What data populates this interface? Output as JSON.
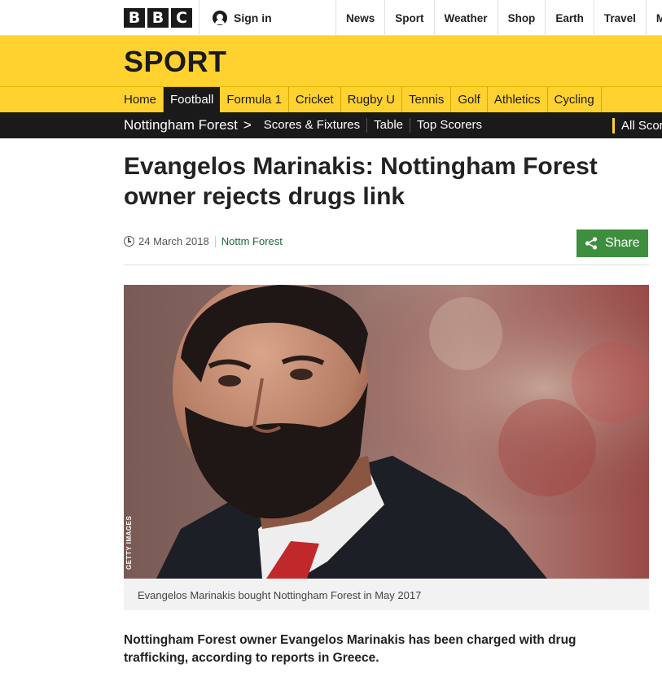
{
  "bbc_logo": [
    "B",
    "B",
    "C"
  ],
  "signin": {
    "label": "Sign in",
    "icon": "user-icon"
  },
  "topnav": [
    "News",
    "Sport",
    "Weather",
    "Shop",
    "Earth",
    "Travel",
    "Mo"
  ],
  "sport_title": "SPORT",
  "sport_nav": {
    "items": [
      "Home",
      "Football",
      "Formula 1",
      "Cricket",
      "Rugby U",
      "Tennis",
      "Golf",
      "Athletics",
      "Cycling"
    ],
    "active": "Football"
  },
  "club_nav": {
    "club": "Nottingham Forest",
    "links": [
      "Scores & Fixtures",
      "Table",
      "Top Scorers"
    ],
    "all_scores": "All Scor"
  },
  "article": {
    "headline": "Evangelos Marinakis: Nottingham Forest owner rejects drugs link",
    "date": "24 March 2018",
    "topic": "Nottm Forest",
    "share_label": "Share",
    "image_credit": "GETTY IMAGES",
    "caption": "Evangelos Marinakis bought Nottingham Forest in May 2017",
    "intro": "Nottingham Forest owner Evangelos Marinakis has been charged with drug trafficking, according to reports in Greece."
  },
  "colors": {
    "sport_yellow": "#ffd230",
    "nav_black": "#1a1a1a",
    "share_green": "#3d8f3d",
    "topic_green": "#1d6b3a"
  }
}
